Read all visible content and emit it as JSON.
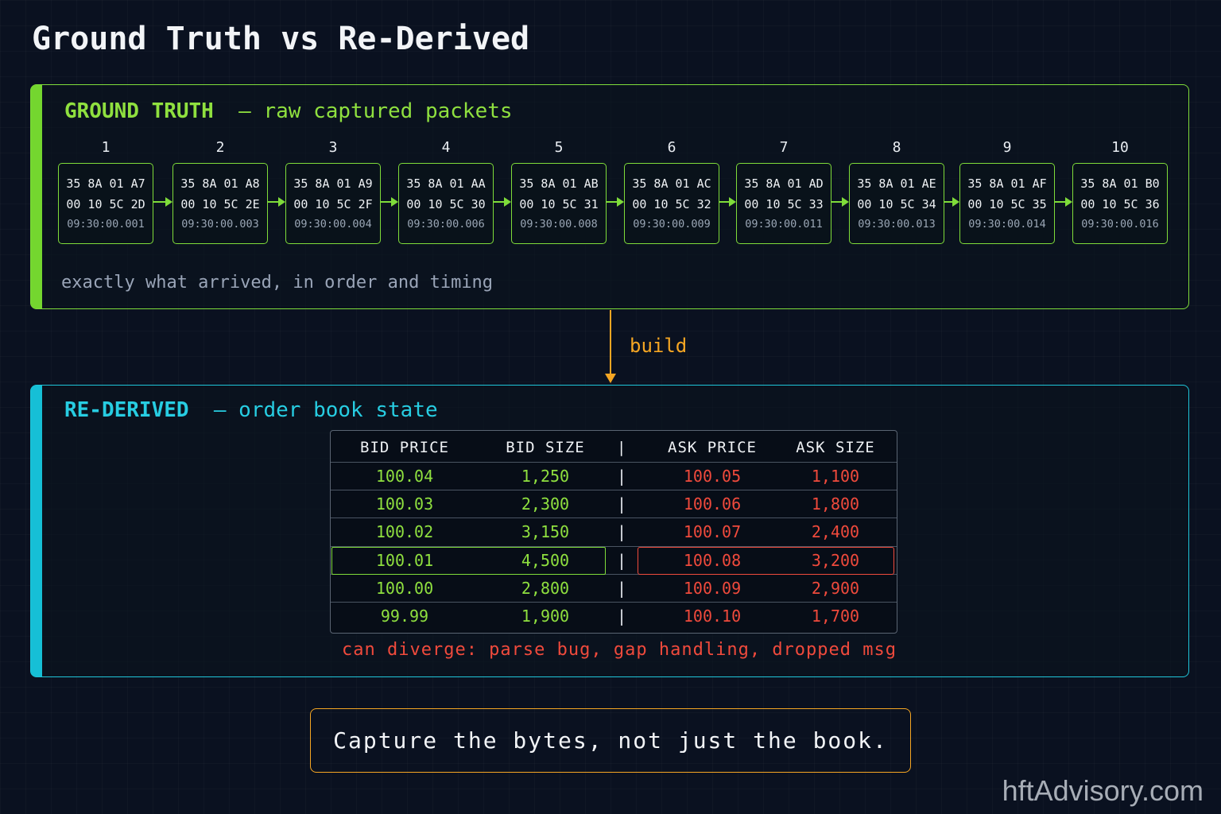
{
  "title": "Ground Truth vs Re-Derived",
  "ground_truth": {
    "label": "GROUND TRUTH",
    "dash": "–",
    "subtitle": "raw captured packets",
    "caption": "exactly what arrived, in order and timing",
    "colors": {
      "accent": "#7fdc3a"
    },
    "packets": [
      {
        "n": "1",
        "hex1": "35 8A 01 A7",
        "hex2": "00 10 5C 2D",
        "ts": "09:30:00.001"
      },
      {
        "n": "2",
        "hex1": "35 8A 01 A8",
        "hex2": "00 10 5C 2E",
        "ts": "09:30:00.003"
      },
      {
        "n": "3",
        "hex1": "35 8A 01 A9",
        "hex2": "00 10 5C 2F",
        "ts": "09:30:00.004"
      },
      {
        "n": "4",
        "hex1": "35 8A 01 AA",
        "hex2": "00 10 5C 30",
        "ts": "09:30:00.006"
      },
      {
        "n": "5",
        "hex1": "35 8A 01 AB",
        "hex2": "00 10 5C 31",
        "ts": "09:30:00.008"
      },
      {
        "n": "6",
        "hex1": "35 8A 01 AC",
        "hex2": "00 10 5C 32",
        "ts": "09:30:00.009"
      },
      {
        "n": "7",
        "hex1": "35 8A 01 AD",
        "hex2": "00 10 5C 33",
        "ts": "09:30:00.011"
      },
      {
        "n": "8",
        "hex1": "35 8A 01 AE",
        "hex2": "00 10 5C 34",
        "ts": "09:30:00.013"
      },
      {
        "n": "9",
        "hex1": "35 8A 01 AF",
        "hex2": "00 10 5C 35",
        "ts": "09:30:00.014"
      },
      {
        "n": "10",
        "hex1": "35 8A 01 B0",
        "hex2": "00 10 5C 36",
        "ts": "09:30:00.016"
      }
    ]
  },
  "build_label": "build",
  "re_derived": {
    "label": "RE-DERIVED",
    "dash": "–",
    "subtitle": "order book state",
    "colors": {
      "accent": "#1fc6da",
      "bid": "#8fe03f",
      "ask": "#f04a3c"
    },
    "headers": {
      "bid_price": "BID PRICE",
      "bid_size": "BID SIZE",
      "sep": "|",
      "ask_price": "ASK PRICE",
      "ask_size": "ASK SIZE"
    },
    "rows": [
      {
        "bid_price": "100.04",
        "bid_size": "1,250",
        "sep": "|",
        "ask_price": "100.05",
        "ask_size": "1,100"
      },
      {
        "bid_price": "100.03",
        "bid_size": "2,300",
        "sep": "|",
        "ask_price": "100.06",
        "ask_size": "1,800"
      },
      {
        "bid_price": "100.02",
        "bid_size": "3,150",
        "sep": "|",
        "ask_price": "100.07",
        "ask_size": "2,400"
      },
      {
        "bid_price": "100.01",
        "bid_size": "4,500",
        "sep": "|",
        "ask_price": "100.08",
        "ask_size": "3,200"
      },
      {
        "bid_price": "100.00",
        "bid_size": "2,800",
        "sep": "|",
        "ask_price": "100.09",
        "ask_size": "2,900"
      },
      {
        "bid_price": "99.99",
        "bid_size": "1,900",
        "sep": "|",
        "ask_price": "100.10",
        "ask_size": "1,700"
      }
    ],
    "highlighted_row": 3,
    "diverge_note": "can diverge: parse bug, gap handling, dropped msg"
  },
  "footer": "Capture the bytes, not just the book.",
  "watermark": "hftAdvisory.com"
}
